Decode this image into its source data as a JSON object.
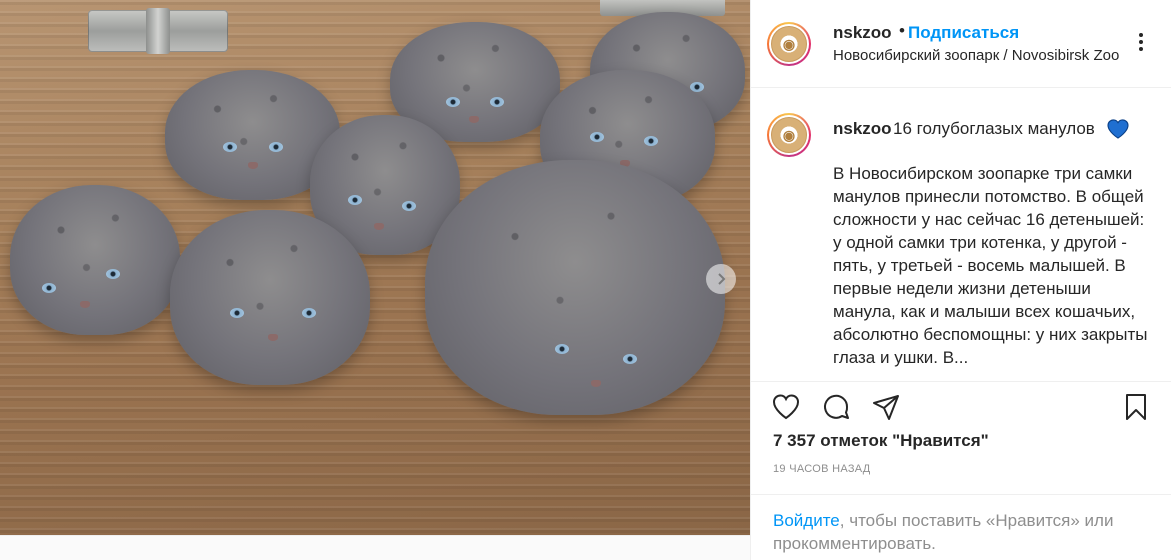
{
  "header": {
    "username": "nskzoo",
    "separator": "•",
    "follow_label": "Подписаться",
    "location": "Новосибирский зоопарк / Novosibirsk Zoo"
  },
  "caption": {
    "username": "nskzoo",
    "title": "16 голубоглазых манулов",
    "body": "В Новосибирском зоопарке три самки манулов принесли потомство. В общей сложности у нас сейчас 16 детенышей: у одной самки три котенка, у другой - пять, у третьей - восемь малышей. В первые недели жизни детеныши манула, как и малыши всех кошачьих, абсолютно беспомощны: у них закрыты глаза и ушки. В..."
  },
  "photo": {
    "subject": "manul kittens on wooden boards",
    "next_icon": "chevron-right-icon"
  },
  "actions": {
    "icons": [
      "heart-icon",
      "comment-icon",
      "share-icon",
      "bookmark-icon"
    ]
  },
  "likes": "7 357 отметок \"Нравится\"",
  "timestamp": "19 ЧАСОВ НАЗАД",
  "login": {
    "link": "Войдите",
    "rest": ", чтобы поставить «Нравится» или прокомментировать."
  },
  "colors": {
    "link_blue": "#0095f6",
    "text": "#262626",
    "muted": "#8e8e8e",
    "border": "#efefef",
    "heart_blue": "#1f6fd1"
  }
}
